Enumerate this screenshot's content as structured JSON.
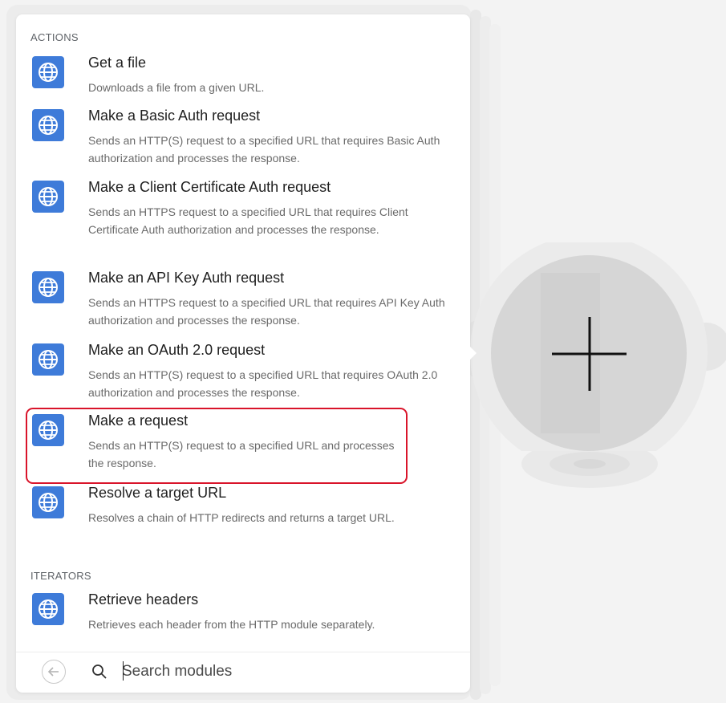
{
  "sections": {
    "actions_title": "ACTIONS",
    "iterators_title": "ITERATORS"
  },
  "actions": [
    {
      "title": "Get a file",
      "description": "Downloads a file from a given URL.",
      "icon": "globe-icon"
    },
    {
      "title": "Make a Basic Auth request",
      "description": "Sends an HTTP(S) request to a specified URL that requires Basic Auth authorization and processes the response.",
      "icon": "globe-icon"
    },
    {
      "title": "Make a Client Certificate Auth request",
      "description": "Sends an HTTPS request to a specified URL that requires Client Certificate Auth authorization and processes the response.",
      "icon": "globe-icon"
    },
    {
      "title": "Make an API Key Auth request",
      "description": "Sends an HTTPS request to a specified URL that requires API Key Auth authorization and processes the response.",
      "icon": "globe-icon"
    },
    {
      "title": "Make an OAuth 2.0 request",
      "description": "Sends an HTTP(S) request to a specified URL that requires OAuth 2.0 authorization and processes the response.",
      "icon": "globe-icon"
    },
    {
      "title": "Make a request",
      "description": "Sends an HTTP(S) request to a specified URL and processes the response.",
      "icon": "globe-icon",
      "highlighted": true
    },
    {
      "title": "Resolve a target URL",
      "description": "Resolves a chain of HTTP redirects and returns a target URL.",
      "icon": "globe-icon"
    }
  ],
  "iterators": [
    {
      "title": "Retrieve headers",
      "description": "Retrieves each header from the HTTP module separately.",
      "icon": "globe-icon"
    }
  ],
  "search": {
    "placeholder": "Search modules",
    "value": ""
  },
  "footer": {
    "back_icon": "arrow-left-circle-icon",
    "search_icon": "search-icon"
  },
  "canvas": {
    "add_icon": "plus-icon"
  },
  "colors": {
    "icon_bg": "#3e7bd9",
    "highlight": "#d9142a",
    "background": "#f3f3f3"
  }
}
